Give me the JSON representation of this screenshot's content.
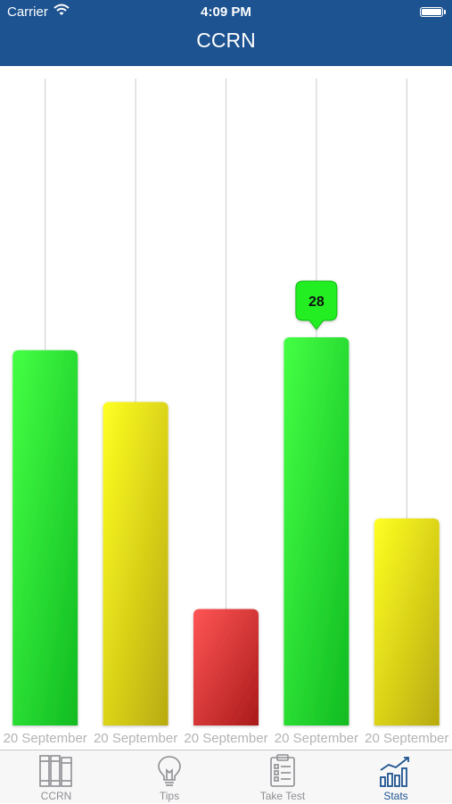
{
  "status_bar": {
    "carrier": "Carrier",
    "time": "4:09 PM"
  },
  "nav": {
    "title": "CCRN"
  },
  "colors": {
    "bar_header": "#1d5390",
    "green": "#22dd22",
    "yellow": "#e6e600",
    "red": "#e02020",
    "tab_active": "#1d5390"
  },
  "chart_data": {
    "type": "bar",
    "categories": [
      "20 September",
      "20 September",
      "20 September",
      "20 September",
      "20 September"
    ],
    "values": [
      29,
      25,
      9,
      30,
      16
    ],
    "bar_colors": [
      "green",
      "yellow",
      "red",
      "green",
      "yellow"
    ],
    "ylim": [
      0,
      50
    ],
    "highlight": {
      "index": 3,
      "label": "28"
    },
    "title": "",
    "xlabel": "",
    "ylabel": "",
    "grid": "vertical"
  },
  "tabs": [
    {
      "label": "CCRN",
      "icon": "books-icon",
      "active": false
    },
    {
      "label": "Tips",
      "icon": "lightbulb-icon",
      "active": false
    },
    {
      "label": "Take Test",
      "icon": "clipboard-icon",
      "active": false
    },
    {
      "label": "Stats",
      "icon": "stats-icon",
      "active": true
    }
  ]
}
